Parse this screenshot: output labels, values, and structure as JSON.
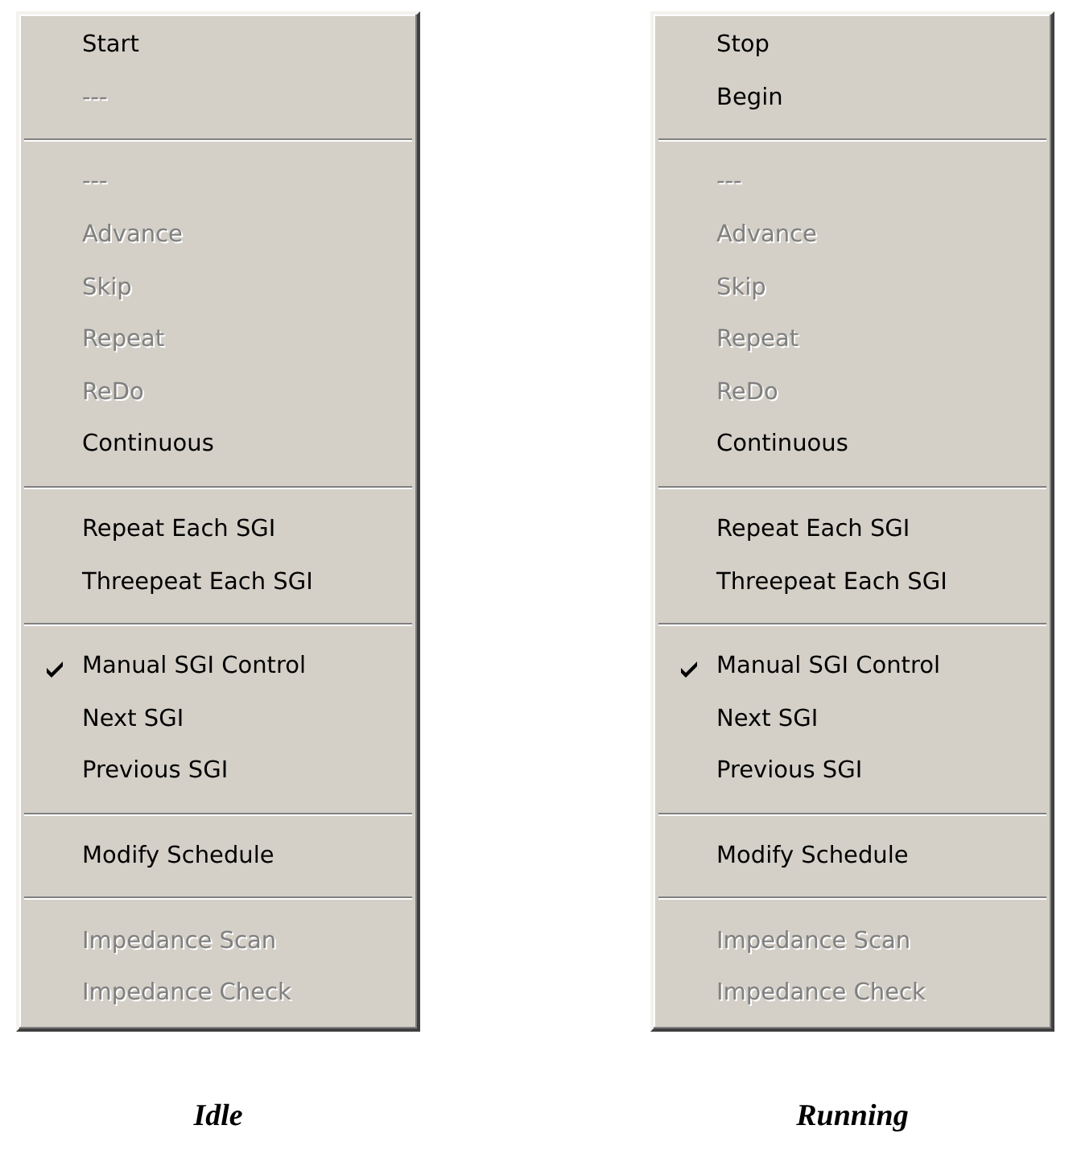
{
  "menus": [
    {
      "caption": "Idle",
      "items": [
        {
          "kind": "item",
          "label": "Start",
          "disabled": false,
          "checked": false
        },
        {
          "kind": "item",
          "label": "---",
          "disabled": true,
          "checked": false
        },
        {
          "kind": "separator"
        },
        {
          "kind": "item",
          "label": "---",
          "disabled": true,
          "checked": false
        },
        {
          "kind": "item",
          "label": "Advance",
          "disabled": true,
          "checked": false
        },
        {
          "kind": "item",
          "label": "Skip",
          "disabled": true,
          "checked": false
        },
        {
          "kind": "item",
          "label": "Repeat",
          "disabled": true,
          "checked": false
        },
        {
          "kind": "item",
          "label": "ReDo",
          "disabled": true,
          "checked": false
        },
        {
          "kind": "item",
          "label": "Continuous",
          "disabled": false,
          "checked": false
        },
        {
          "kind": "separator"
        },
        {
          "kind": "item",
          "label": "Repeat Each SGI",
          "disabled": false,
          "checked": false
        },
        {
          "kind": "item",
          "label": "Threepeat Each SGI",
          "disabled": false,
          "checked": false
        },
        {
          "kind": "separator"
        },
        {
          "kind": "item",
          "label": "Manual SGI Control",
          "disabled": false,
          "checked": true
        },
        {
          "kind": "item",
          "label": "Next SGI",
          "disabled": false,
          "checked": false
        },
        {
          "kind": "item",
          "label": "Previous SGI",
          "disabled": false,
          "checked": false
        },
        {
          "kind": "separator"
        },
        {
          "kind": "item",
          "label": "Modify Schedule",
          "disabled": false,
          "checked": false
        },
        {
          "kind": "separator"
        },
        {
          "kind": "item",
          "label": "Impedance Scan",
          "disabled": true,
          "checked": false
        },
        {
          "kind": "item",
          "label": "Impedance Check",
          "disabled": true,
          "checked": false
        }
      ]
    },
    {
      "caption": "Running",
      "items": [
        {
          "kind": "item",
          "label": "Stop",
          "disabled": false,
          "checked": false
        },
        {
          "kind": "item",
          "label": "Begin",
          "disabled": false,
          "checked": false
        },
        {
          "kind": "separator"
        },
        {
          "kind": "item",
          "label": "---",
          "disabled": true,
          "checked": false
        },
        {
          "kind": "item",
          "label": "Advance",
          "disabled": true,
          "checked": false
        },
        {
          "kind": "item",
          "label": "Skip",
          "disabled": true,
          "checked": false
        },
        {
          "kind": "item",
          "label": "Repeat",
          "disabled": true,
          "checked": false
        },
        {
          "kind": "item",
          "label": "ReDo",
          "disabled": true,
          "checked": false
        },
        {
          "kind": "item",
          "label": "Continuous",
          "disabled": false,
          "checked": false
        },
        {
          "kind": "separator"
        },
        {
          "kind": "item",
          "label": "Repeat Each SGI",
          "disabled": false,
          "checked": false
        },
        {
          "kind": "item",
          "label": "Threepeat Each SGI",
          "disabled": false,
          "checked": false
        },
        {
          "kind": "separator"
        },
        {
          "kind": "item",
          "label": "Manual SGI Control",
          "disabled": false,
          "checked": true
        },
        {
          "kind": "item",
          "label": "Next SGI",
          "disabled": false,
          "checked": false
        },
        {
          "kind": "item",
          "label": "Previous SGI",
          "disabled": false,
          "checked": false
        },
        {
          "kind": "separator"
        },
        {
          "kind": "item",
          "label": "Modify Schedule",
          "disabled": false,
          "checked": false
        },
        {
          "kind": "separator"
        },
        {
          "kind": "item",
          "label": "Impedance Scan",
          "disabled": true,
          "checked": false
        },
        {
          "kind": "item",
          "label": "Impedance Check",
          "disabled": true,
          "checked": false
        }
      ]
    }
  ]
}
